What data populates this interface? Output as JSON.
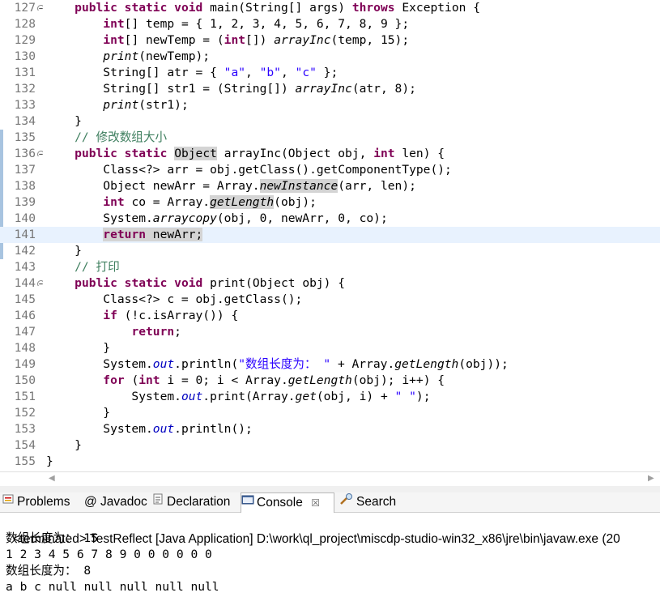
{
  "editor": {
    "lines": [
      {
        "n": "127",
        "fold": "minus",
        "segs": [
          [
            "    ",
            ""
          ],
          [
            "public static void",
            "kw"
          ],
          [
            " main(String[] args) ",
            ""
          ],
          [
            "throws",
            "kw"
          ],
          [
            " Exception {",
            ""
          ]
        ]
      },
      {
        "n": "128",
        "segs": [
          [
            "        ",
            ""
          ],
          [
            "int",
            "kw"
          ],
          [
            "[] temp = { 1, 2, 3, 4, 5, 6, 7, 8, 9 };",
            ""
          ]
        ]
      },
      {
        "n": "129",
        "segs": [
          [
            "        ",
            ""
          ],
          [
            "int",
            "kw"
          ],
          [
            "[] newTemp = (",
            ""
          ],
          [
            "int",
            "kw"
          ],
          [
            "[]) ",
            ""
          ],
          [
            "arrayInc",
            "it"
          ],
          [
            "(temp, 15);",
            ""
          ]
        ]
      },
      {
        "n": "130",
        "segs": [
          [
            "        ",
            ""
          ],
          [
            "print",
            "it"
          ],
          [
            "(newTemp);",
            ""
          ]
        ]
      },
      {
        "n": "131",
        "segs": [
          [
            "        String[] atr = { ",
            ""
          ],
          [
            "\"a\"",
            "str"
          ],
          [
            ", ",
            ""
          ],
          [
            "\"b\"",
            "str"
          ],
          [
            ", ",
            ""
          ],
          [
            "\"c\"",
            "str"
          ],
          [
            " };",
            ""
          ]
        ]
      },
      {
        "n": "132",
        "segs": [
          [
            "        String[] str1 = (String[]) ",
            ""
          ],
          [
            "arrayInc",
            "it"
          ],
          [
            "(atr, 8);",
            ""
          ]
        ]
      },
      {
        "n": "133",
        "segs": [
          [
            "        ",
            ""
          ],
          [
            "print",
            "it"
          ],
          [
            "(str1);",
            ""
          ]
        ]
      },
      {
        "n": "134",
        "segs": [
          [
            "    }",
            ""
          ]
        ]
      },
      {
        "n": "135",
        "segs": [
          [
            "    // 修改数组大小",
            "cm"
          ]
        ]
      },
      {
        "n": "136",
        "fold": "minus",
        "segs": [
          [
            "    ",
            ""
          ],
          [
            "public static",
            "kw"
          ],
          [
            " ",
            ""
          ],
          [
            "Object",
            "occ"
          ],
          [
            " arrayInc(Object obj, ",
            ""
          ],
          [
            "int",
            "kw"
          ],
          [
            " len) {",
            ""
          ]
        ]
      },
      {
        "n": "137",
        "segs": [
          [
            "        Class<?> arr = obj.getClass().getComponentType();",
            ""
          ]
        ]
      },
      {
        "n": "138",
        "segs": [
          [
            "        Object newArr = Array.",
            ""
          ],
          [
            "newInstance",
            "it occ"
          ],
          [
            "(arr, len);",
            ""
          ]
        ]
      },
      {
        "n": "139",
        "segs": [
          [
            "        ",
            ""
          ],
          [
            "int",
            "kw"
          ],
          [
            " co = Array.",
            ""
          ],
          [
            "getLength",
            "it occ"
          ],
          [
            "(obj);",
            ""
          ]
        ]
      },
      {
        "n": "140",
        "segs": [
          [
            "        System.",
            ""
          ],
          [
            "arraycopy",
            "it"
          ],
          [
            "(obj, 0, newArr, 0, co);",
            ""
          ]
        ]
      },
      {
        "n": "141",
        "hl": true,
        "segs": [
          [
            "        ",
            ""
          ],
          [
            "return",
            "kw occ"
          ],
          [
            " newArr;",
            "occ"
          ]
        ]
      },
      {
        "n": "142",
        "segs": [
          [
            "    }",
            ""
          ]
        ]
      },
      {
        "n": "143",
        "segs": [
          [
            "    // 打印",
            "cm"
          ]
        ]
      },
      {
        "n": "144",
        "fold": "minus",
        "segs": [
          [
            "    ",
            ""
          ],
          [
            "public static void",
            "kw"
          ],
          [
            " print(Object obj) {",
            ""
          ]
        ]
      },
      {
        "n": "145",
        "segs": [
          [
            "        Class<?> c = obj.getClass();",
            ""
          ]
        ]
      },
      {
        "n": "146",
        "segs": [
          [
            "        ",
            ""
          ],
          [
            "if",
            "kw"
          ],
          [
            " (!c.isArray()) {",
            ""
          ]
        ]
      },
      {
        "n": "147",
        "segs": [
          [
            "            ",
            ""
          ],
          [
            "return",
            "kw"
          ],
          [
            ";",
            ""
          ]
        ]
      },
      {
        "n": "148",
        "segs": [
          [
            "        }",
            ""
          ]
        ]
      },
      {
        "n": "149",
        "segs": [
          [
            "        System.",
            ""
          ],
          [
            "out",
            "st"
          ],
          [
            ".println(",
            ""
          ],
          [
            "\"数组长度为： \"",
            "str"
          ],
          [
            " + Array.",
            ""
          ],
          [
            "getLength",
            "it"
          ],
          [
            "(obj));",
            ""
          ]
        ]
      },
      {
        "n": "150",
        "segs": [
          [
            "        ",
            ""
          ],
          [
            "for",
            "kw"
          ],
          [
            " (",
            ""
          ],
          [
            "int",
            "kw"
          ],
          [
            " i = 0; i < Array.",
            ""
          ],
          [
            "getLength",
            "it"
          ],
          [
            "(obj); i++) {",
            ""
          ]
        ]
      },
      {
        "n": "151",
        "segs": [
          [
            "            System.",
            ""
          ],
          [
            "out",
            "st"
          ],
          [
            ".print(Array.",
            ""
          ],
          [
            "get",
            "it"
          ],
          [
            "(obj, i) + ",
            ""
          ],
          [
            "\" \"",
            "str"
          ],
          [
            ");",
            ""
          ]
        ]
      },
      {
        "n": "152",
        "segs": [
          [
            "        }",
            ""
          ]
        ]
      },
      {
        "n": "153",
        "segs": [
          [
            "        System.",
            ""
          ],
          [
            "out",
            "st"
          ],
          [
            ".println();",
            ""
          ]
        ]
      },
      {
        "n": "154",
        "segs": [
          [
            "    }",
            ""
          ]
        ]
      },
      {
        "n": "155",
        "segs": [
          [
            "}",
            ""
          ]
        ]
      }
    ]
  },
  "tabs": [
    {
      "label": "Problems",
      "icon": "problems-icon",
      "active": false
    },
    {
      "label": "@ Javadoc",
      "icon": "",
      "active": false
    },
    {
      "label": "Declaration",
      "icon": "declaration-icon",
      "active": false
    },
    {
      "label": "Console",
      "icon": "console-icon",
      "active": true,
      "close": "☒"
    },
    {
      "label": "Search",
      "icon": "search-icon",
      "active": false
    }
  ],
  "console": {
    "header": "<terminated> TestReflect [Java Application] D:\\work\\ql_project\\miscdp-studio-win32_x86\\jre\\bin\\javaw.exe (20",
    "lines": [
      "数组长度为： 15",
      "1 2 3 4 5 6 7 8 9 0 0 0 0 0 0",
      "数组长度为： 8",
      "a b c null null null null null"
    ]
  },
  "colors": {
    "keyword": "#7f0055",
    "string": "#2a00ff",
    "comment": "#3f7f5f",
    "static_field": "#0000c0",
    "current_line": "#e8f2fe",
    "occurrence": "#d4d4d4"
  }
}
